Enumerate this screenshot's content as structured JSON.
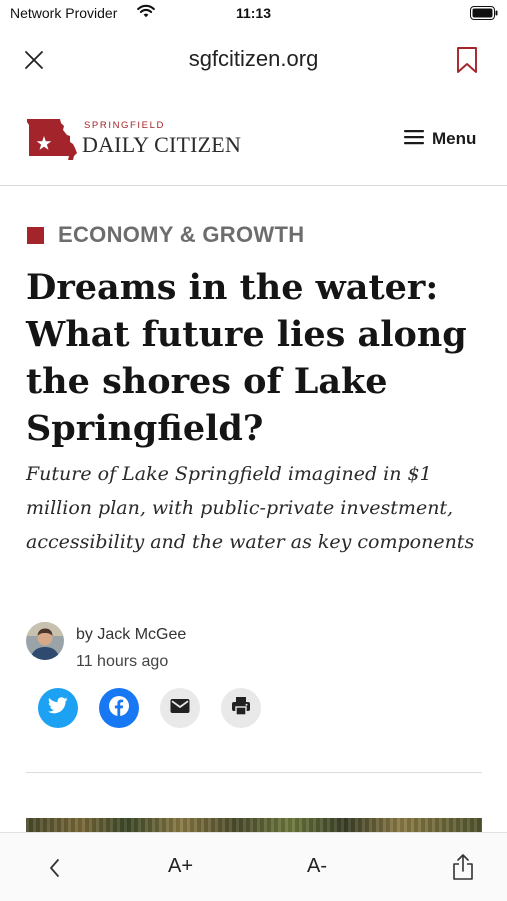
{
  "status_bar": {
    "carrier": "Network Provider",
    "time": "11:13",
    "icons": [
      "wifi-icon",
      "battery-icon"
    ]
  },
  "browser": {
    "url": "sgfcitizen.org",
    "icons": [
      "close-icon",
      "bookmark-icon"
    ]
  },
  "site": {
    "logo_top": "SPRINGFIELD",
    "logo_main": "DAILY CITIZEN",
    "menu_label": "Menu",
    "brand_color": "#a3242a"
  },
  "article": {
    "section": "ECONOMY & GROWTH",
    "headline": "Dreams in the water: What future lies along the shores of Lake Springfield?",
    "subhead": "Future of Lake Springfield imagined in $1 million plan, with public-private investment, accessibility and the water as key components",
    "author": "by Jack McGee",
    "time_ago": "11 hours ago",
    "share_icons": [
      "twitter-icon",
      "facebook-icon",
      "email-icon",
      "print-icon"
    ]
  },
  "toolbar": {
    "increase_text": "A+",
    "decrease_text": "A-",
    "icons": [
      "back-icon",
      "share-icon"
    ]
  }
}
